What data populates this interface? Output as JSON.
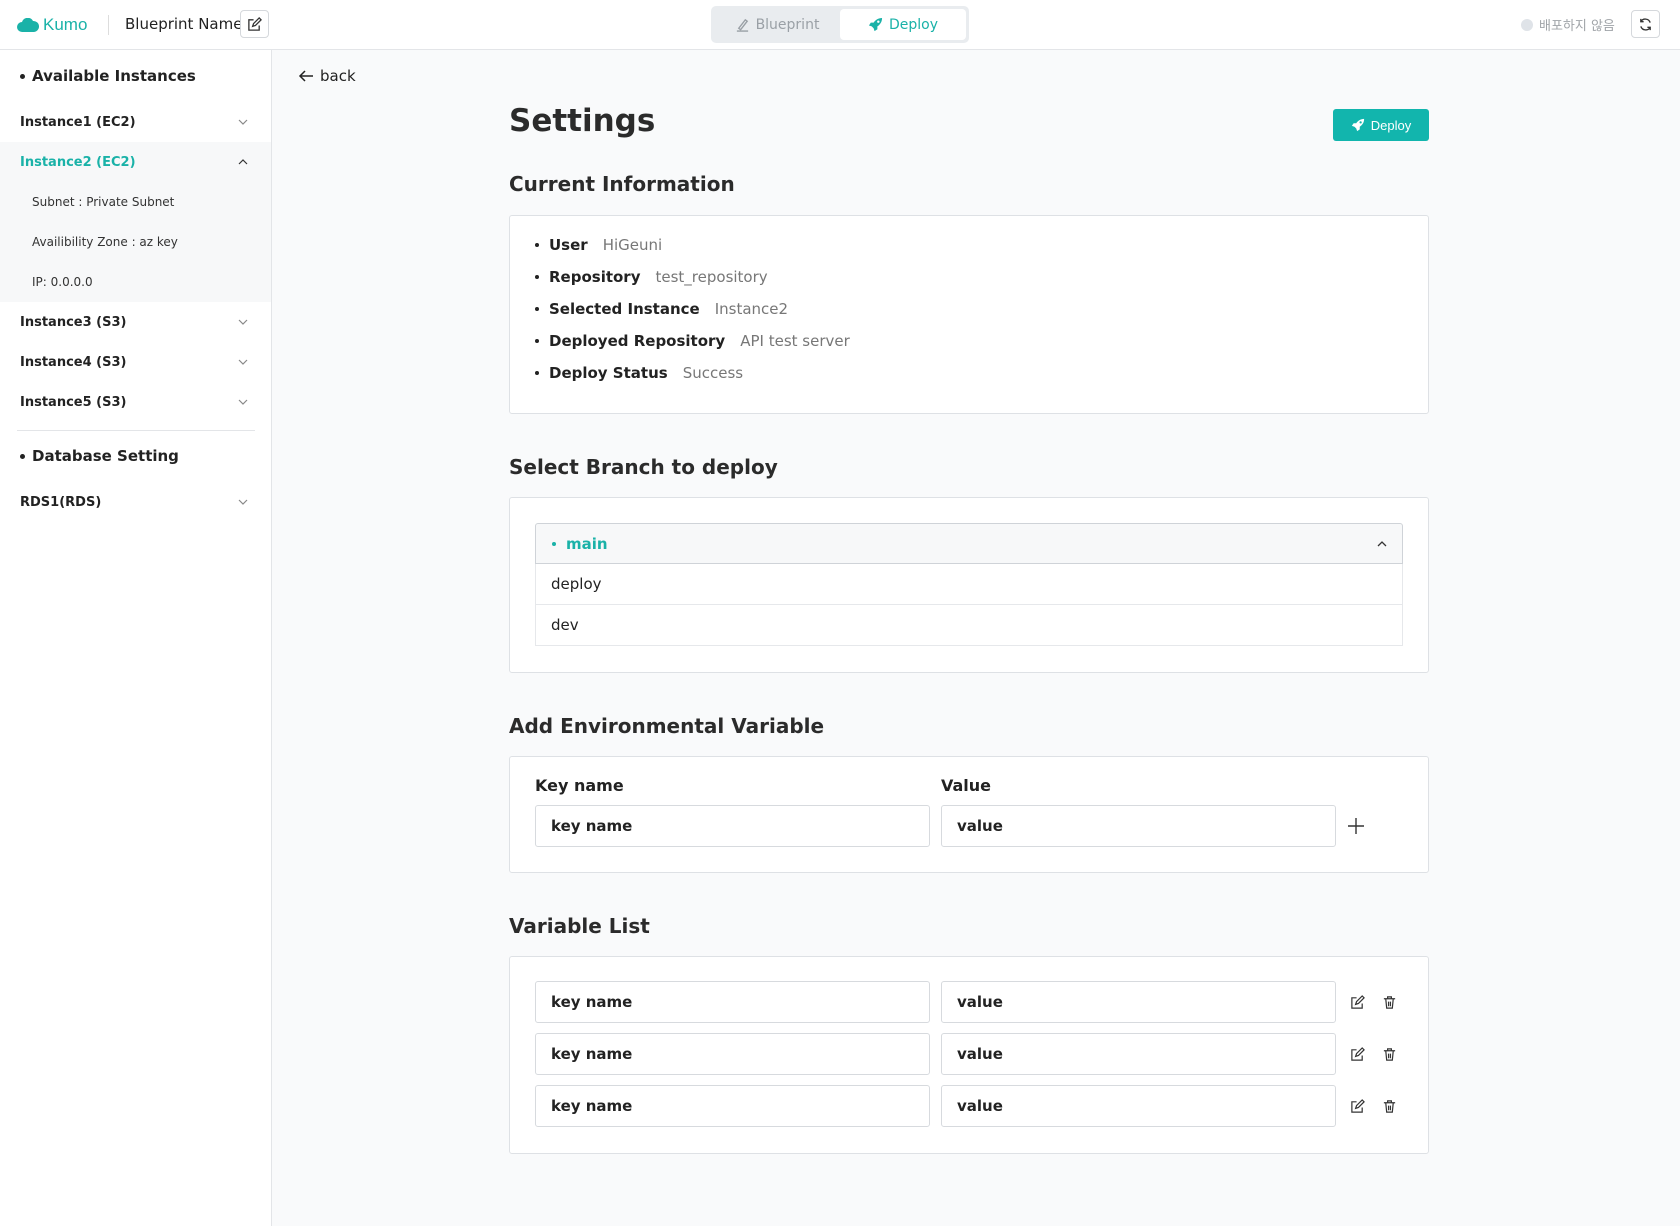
{
  "header": {
    "brand": "Kumo",
    "blueprint_name": "Blueprint Name",
    "tabs": [
      {
        "label": "Blueprint",
        "active": false
      },
      {
        "label": "Deploy",
        "active": true
      }
    ],
    "status_text": "배포하지 않음"
  },
  "sidebar": {
    "instances_title": "Available Instances",
    "instances": [
      {
        "label": "Instance1 (EC2)",
        "expanded": false
      },
      {
        "label": "Instance2 (EC2)",
        "expanded": true,
        "details": [
          "Subnet : Private Subnet",
          "Availibility Zone : az key",
          "IP: 0.0.0.0"
        ]
      },
      {
        "label": "Instance3 (S3)",
        "expanded": false
      },
      {
        "label": "Instance4 (S3)",
        "expanded": false
      },
      {
        "label": "Instance5 (S3)",
        "expanded": false
      }
    ],
    "database_title": "Database Setting",
    "databases": [
      {
        "label": "RDS1(RDS)",
        "expanded": false
      }
    ]
  },
  "main": {
    "back_label": "back",
    "title": "Settings",
    "deploy_button": "Deploy",
    "current_info": {
      "heading": "Current Information",
      "rows": [
        {
          "label": "User",
          "value": "HiGeuni"
        },
        {
          "label": "Repository",
          "value": "test_repository"
        },
        {
          "label": "Selected Instance",
          "value": "Instance2"
        },
        {
          "label": "Deployed Repository",
          "value": "API test server"
        },
        {
          "label": "Deploy Status",
          "value": "Success"
        }
      ]
    },
    "branch": {
      "heading": "Select Branch to deploy",
      "selected": "main",
      "options": [
        "deploy",
        "dev"
      ]
    },
    "env": {
      "heading": "Add Environmental Variable",
      "key_label": "Key name",
      "value_label": "Value",
      "key_value": "key name",
      "value_value": "value"
    },
    "var_list": {
      "heading": "Variable List",
      "rows": [
        {
          "key": "key name",
          "value": "value"
        },
        {
          "key": "key name",
          "value": "value"
        },
        {
          "key": "key name",
          "value": "value"
        }
      ]
    }
  },
  "colors": {
    "accent": "#1ab2a8",
    "deploy_button": "#12b5ad"
  }
}
